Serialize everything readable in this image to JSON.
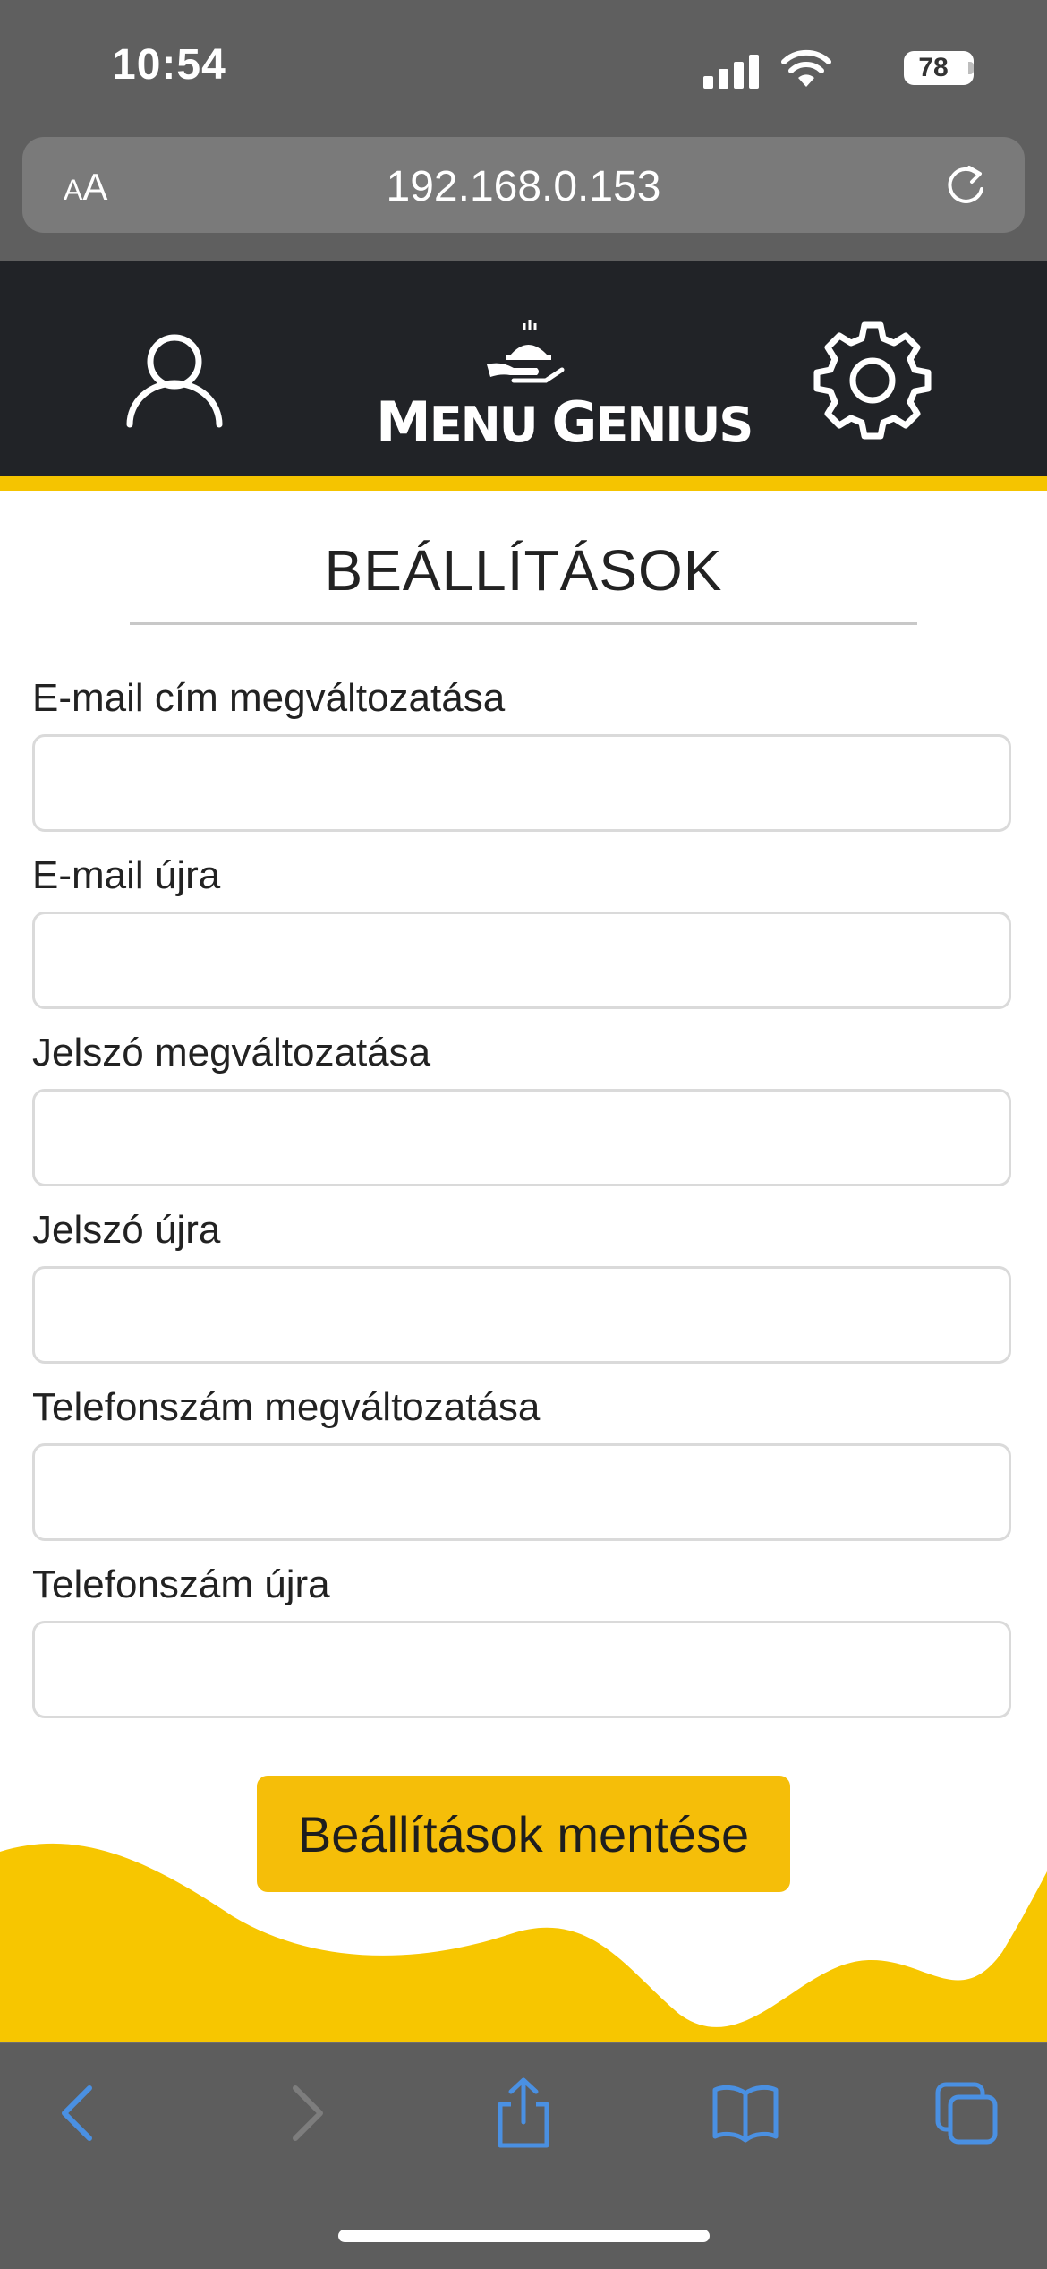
{
  "status_bar": {
    "time": "10:54",
    "battery": "78"
  },
  "browser": {
    "aa_small": "A",
    "aa_large": "A",
    "url": "192.168.0.153"
  },
  "header": {
    "logo_text_first_big": "M",
    "logo_text_first_rest": "ENU ",
    "logo_text_second_big": "G",
    "logo_text_second_rest": "ENIUS"
  },
  "page": {
    "title": "BEÁLLÍTÁSOK"
  },
  "form": {
    "fields": [
      {
        "label": "E-mail cím megváltozatása",
        "value": "",
        "placeholder": ""
      },
      {
        "label": "E-mail újra",
        "value": "",
        "placeholder": ""
      },
      {
        "label": "Jelszó megváltozatása",
        "value": "",
        "placeholder": ""
      },
      {
        "label": "Jelszó újra",
        "value": "",
        "placeholder": ""
      },
      {
        "label": "Telefonszám megváltozatása",
        "value": "",
        "placeholder": ""
      },
      {
        "label": "Telefonszám újra",
        "value": "",
        "placeholder": ""
      }
    ],
    "save_label": "Beállítások mentése"
  },
  "colors": {
    "accent": "#f5c400",
    "header_bg": "#212327",
    "button": "#f5be09",
    "browser_chrome": "#5f5f5f",
    "toolbar_icon": "#4a90e2"
  },
  "icons": [
    "signal-icon",
    "wifi-icon",
    "battery-icon",
    "reload-icon",
    "profile-icon",
    "logo-icon",
    "settings-icon",
    "back-icon",
    "forward-icon",
    "share-icon",
    "bookmarks-icon",
    "tabs-icon"
  ]
}
